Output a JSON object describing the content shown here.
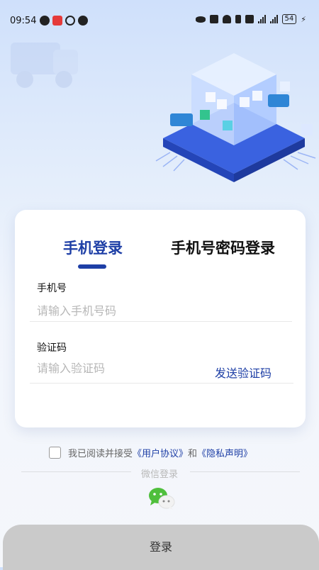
{
  "status_bar": {
    "time": "09:54",
    "battery": "54",
    "left_icons": [
      "heart-icon",
      "bank-icon",
      "location-icon",
      "message-icon"
    ],
    "right_icons": [
      "eye-icon",
      "nfc-icon",
      "headphones-icon",
      "battery-saver-icon",
      "mute-icon",
      "signal-icon",
      "signal-5g-icon"
    ]
  },
  "tabs": {
    "active": "手机登录",
    "inactive": "手机号密码登录"
  },
  "form": {
    "phone_label": "手机号",
    "phone_placeholder": "请输入手机号码",
    "code_label": "验证码",
    "code_placeholder": "请输入验证码",
    "send_code": "发送验证码"
  },
  "agreement": {
    "prefix": "我已阅读并接受",
    "user_agreement": "《用户协议》",
    "and": "和",
    "privacy": "《隐私声明》"
  },
  "wechat_login": "微信登录",
  "login_button": "登录",
  "colors": {
    "accent": "#1e3fa6",
    "button_bg": "#cacaca"
  }
}
